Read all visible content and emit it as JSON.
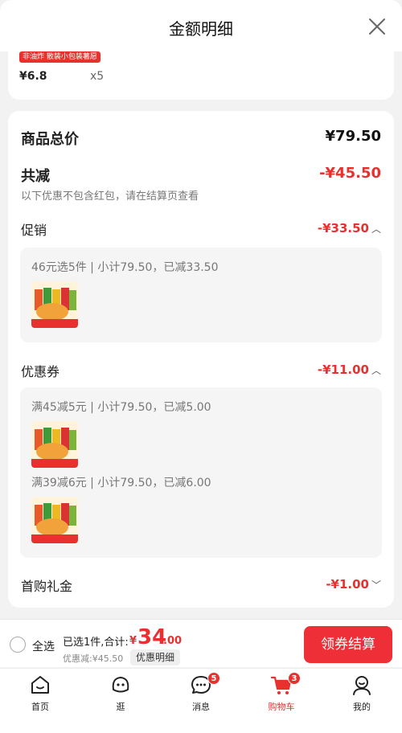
{
  "sheet": {
    "title": "金额明细"
  },
  "top_item": {
    "tag": "非油炸 散装小包装薯愿",
    "price": "¥6.8",
    "qty": "x5"
  },
  "summary": {
    "total_label": "商品总价",
    "total_value": "¥79.50",
    "reduce_label": "共减",
    "reduce_value": "-¥45.50",
    "note": "以下优惠不包含红包，请在结算页查看"
  },
  "sections": {
    "promo": {
      "label": "促销",
      "value": "-¥33.50",
      "line": "46元选5件 | 小计79.50，已减33.50"
    },
    "coupon": {
      "label": "优惠券",
      "value": "-¥11.00",
      "line1": "满45减5元 | 小计79.50，已减5.00",
      "line2": "满39减6元 | 小计79.50，已减6.00"
    },
    "first_gift": {
      "label": "首购礼金",
      "value": "-¥1.00"
    }
  },
  "thumb": {
    "caption": "非油炸 散装小包装薯愿"
  },
  "bottom": {
    "select_all": "全选",
    "selected": "已选1件,合计:",
    "currency": "¥",
    "total_int": "34",
    "total_dec": ".00",
    "discount": "优惠减:¥45.50",
    "detail": "优惠明细",
    "checkout": "领券结算"
  },
  "tabs": [
    {
      "label": "首页",
      "icon": "home-icon"
    },
    {
      "label": "逛",
      "icon": "browse-icon"
    },
    {
      "label": "消息",
      "icon": "message-icon",
      "badge": "5"
    },
    {
      "label": "购物车",
      "icon": "cart-icon",
      "badge": "3",
      "active": true
    },
    {
      "label": "我的",
      "icon": "profile-icon"
    }
  ],
  "colors": {
    "accent": "#e8312f",
    "checkout": "#ef2f38"
  }
}
